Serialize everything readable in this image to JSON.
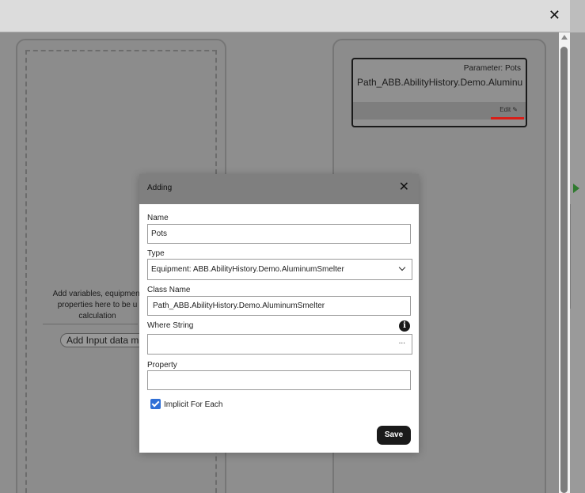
{
  "background": {
    "topbar_close": "✕",
    "left_panel": {
      "hint_lines": [
        "Add variables, equipment",
        "properties here to be u",
        "calculation"
      ],
      "add_button_label": "Add Input data m"
    },
    "right_panel": {
      "param_label": "Parameter: Pots",
      "param_value": "Path_ABB.AbilityHistory.Demo.Aluminu",
      "edit_label": "Edit ✎"
    }
  },
  "modal": {
    "title": "Adding",
    "close_glyph": "✕",
    "name": {
      "label": "Name",
      "value": "Pots"
    },
    "type": {
      "label": "Type",
      "value": "Equipment: ABB.AbilityHistory.Demo.AluminumSmelter"
    },
    "class_name": {
      "label": "Class Name",
      "value": "Path_ABB.AbilityHistory.Demo.AluminumSmelter"
    },
    "where_string": {
      "label": "Where String",
      "value": "",
      "button": "..."
    },
    "property": {
      "label": "Property",
      "value": ""
    },
    "implicit": {
      "label": "Implicit For Each",
      "checked": true
    },
    "save_label": "Save"
  },
  "icons": {
    "info": "i",
    "checkbox_color": "#2f6fd6",
    "accent_red": "#d91e18",
    "arrow_green": "#2f7a2f"
  }
}
